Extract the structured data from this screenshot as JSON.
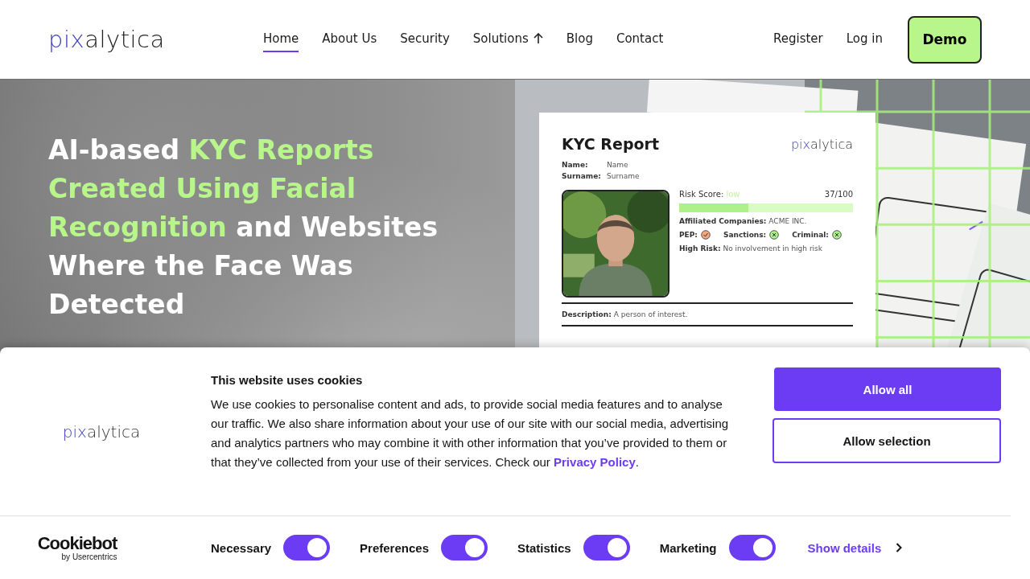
{
  "header": {
    "logo": {
      "lead": "pix",
      "tail": "alytica"
    },
    "nav": [
      {
        "label": "Home",
        "selected": true,
        "has_arrow": false
      },
      {
        "label": "About Us",
        "selected": false,
        "has_arrow": false
      },
      {
        "label": "Security",
        "selected": false,
        "has_arrow": false
      },
      {
        "label": "Solutions",
        "selected": false,
        "has_arrow": true
      },
      {
        "label": "Blog",
        "selected": false,
        "has_arrow": false
      },
      {
        "label": "Contact",
        "selected": false,
        "has_arrow": false
      }
    ],
    "links": [
      "Register",
      "Log in"
    ],
    "demo_button": "Demo"
  },
  "hero": {
    "headline": [
      [
        {
          "text": "AI-based ",
          "highlight": false
        },
        {
          "text": "KYC Reports",
          "highlight": true
        }
      ],
      [
        {
          "text": "Created Using Facial",
          "highlight": true
        }
      ],
      [
        {
          "text": "Recognition",
          "highlight": true
        },
        {
          "text": " and Websites",
          "highlight": false
        }
      ],
      [
        {
          "text": "Where the Face Was",
          "highlight": false
        }
      ],
      [
        {
          "text": "Detected",
          "highlight": false
        }
      ]
    ],
    "report": {
      "title": "KYC Report",
      "logo": {
        "lead": "pix",
        "tail": "alytica"
      },
      "fields": [
        {
          "label": "Name:",
          "value": "Name"
        },
        {
          "label": "Surname:",
          "value": "Surname"
        }
      ],
      "risk_label": "Risk Score:",
      "risk_value": "low",
      "risk_reading": "37/100",
      "level": 0.4,
      "companies_label": "Affiliated Companies:",
      "companies_value": "ACME INC.",
      "checks": [
        {
          "label": "PEP:",
          "kind": "check"
        },
        {
          "label": "Sanctions:",
          "kind": "cross"
        },
        {
          "label": "Criminal:",
          "kind": "cross"
        }
      ],
      "high_risk_label": "High Risk:",
      "high_risk_value": "No involvement in high risk",
      "description_label": "Description:",
      "description_value": "A person of interest."
    }
  },
  "cookie_banner": {
    "logo": {
      "lead": "pix",
      "tail": "alytica"
    },
    "title": "This website uses cookies",
    "body": "We use cookies to personalise content and ads, to provide social media features and to analyse our traffic. We also share information about your use of our site with our social media, advertising and analytics partners who may combine it with other information that you’ve provided to them or that they’ve collected from your use of their services. Check our",
    "link": "Privacy Policy",
    "after_link": ".",
    "buttons": [
      {
        "label": "Allow all",
        "kind": "primary"
      },
      {
        "label": "Allow selection",
        "kind": "outline"
      }
    ],
    "brand": {
      "name": "Cookiebot",
      "tagline": "by Usercentrics"
    },
    "toggles": [
      {
        "label": "Necessary",
        "checked": true
      },
      {
        "label": "Preferences",
        "checked": true
      },
      {
        "label": "Statistics",
        "checked": true
      },
      {
        "label": "Marketing",
        "checked": true
      }
    ],
    "details_link": "Show details"
  }
}
